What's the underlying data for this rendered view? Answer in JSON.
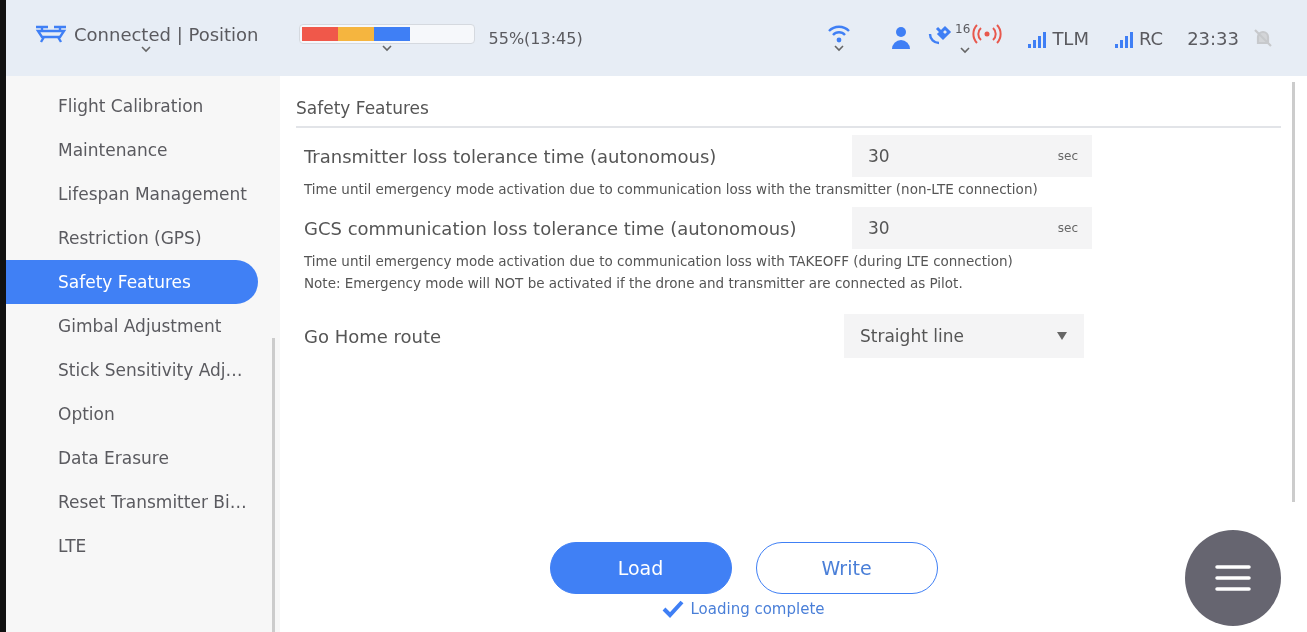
{
  "status_bar": {
    "connection": "Connected | Position",
    "battery": {
      "segments": [
        {
          "color": "#f0584a"
        },
        {
          "color": "#f5b53f"
        },
        {
          "color": "#3f7ff5"
        }
      ],
      "reading": "55%(13:45)"
    },
    "satellites": "16",
    "tlm": "TLM",
    "rc": "RC",
    "time": "23:33"
  },
  "sidebar": {
    "items": [
      {
        "label": "Flight Calibration",
        "selected": false
      },
      {
        "label": "Maintenance",
        "selected": false
      },
      {
        "label": "Lifespan Management",
        "selected": false
      },
      {
        "label": "Restriction (GPS)",
        "selected": false
      },
      {
        "label": "Safety Features",
        "selected": true
      },
      {
        "label": "Gimbal Adjustment",
        "selected": false
      },
      {
        "label": "Stick Sensitivity Adj…",
        "selected": false
      },
      {
        "label": "Option",
        "selected": false
      },
      {
        "label": "Data Erasure",
        "selected": false
      },
      {
        "label": "Reset Transmitter Bi…",
        "selected": false
      },
      {
        "label": "LTE",
        "selected": false
      }
    ]
  },
  "section_title": "Safety Features",
  "settings": [
    {
      "kind": "number",
      "label": "Transmitter loss tolerance time (autonomous)",
      "value": "30",
      "unit": "sec",
      "notes": [
        "Time until emergency mode activation due to communication loss with the transmitter (non-LTE connection)"
      ]
    },
    {
      "kind": "number",
      "label": "GCS communication loss tolerance time (autonomous)",
      "value": "30",
      "unit": "sec",
      "notes": [
        "Time until emergency mode activation due to communication loss with TAKEOFF (during LTE connection)",
        "Note: Emergency mode will NOT be activated if the drone and transmitter are connected as Pilot."
      ]
    },
    {
      "kind": "select",
      "label": "Go Home route",
      "value": "Straight line"
    }
  ],
  "buttons": {
    "load": "Load",
    "write": "Write"
  },
  "status_message": "Loading complete"
}
